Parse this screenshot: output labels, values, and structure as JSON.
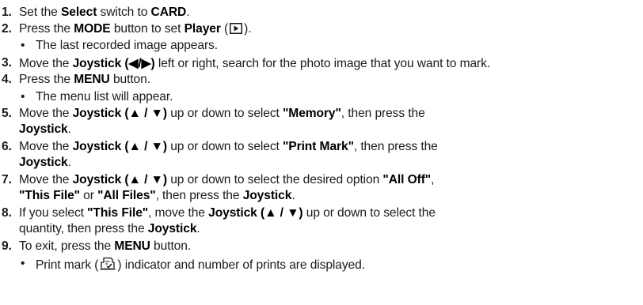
{
  "steps": [
    {
      "num": "1.",
      "a": "Set the ",
      "b1": "Select",
      "c": " switch to ",
      "b2": "CARD",
      "d": "."
    },
    {
      "num": "2.",
      "a": "Press the ",
      "b1": "MODE",
      "c": " button to set ",
      "b2": "Player",
      "d": " (",
      "e": ").",
      "icon": "play-mode-icon"
    },
    {
      "bullet": "The last recorded image appears."
    },
    {
      "num": "3.",
      "a": "Move the ",
      "b1": "Joystick (◀/▶)",
      "c": " left or right, search for the photo image that you want to mark."
    },
    {
      "num": "4.",
      "a": "Press the ",
      "b1": "MENU",
      "c": " button."
    },
    {
      "bullet": "The menu list will appear."
    },
    {
      "num": "5.",
      "a": "Move the ",
      "b1": "Joystick (▲ / ▼)",
      "c": " up or down to select ",
      "b2": "\"Memory\"",
      "d": ", then press the",
      "line2": "Joystick",
      "line2_end": "."
    },
    {
      "num": "6.",
      "a": "Move the ",
      "b1": "Joystick (▲ / ▼)",
      "c": " up or down to select ",
      "b2": "\"Print Mark\"",
      "d": ", then press the",
      "line2": "Joystick",
      "line2_end": "."
    },
    {
      "num": "7.",
      "a": "Move the ",
      "b1": "Joystick (▲ / ▼)",
      "c": " up or down to select the desired option ",
      "b2": "\"All Off\"",
      "d": ",",
      "l2a": "\"This File\"",
      "l2b": " or ",
      "l2c": "\"All Files\"",
      "l2d": ", then press the ",
      "l2e": "Joystick",
      "l2f": "."
    },
    {
      "num": "8.",
      "a": "If you select ",
      "b1": "\"This File\"",
      "c": ", move the ",
      "b2": "Joystick (▲ / ▼)",
      "d": " up or down to select the",
      "l2a": "quantity, then press the ",
      "l2b": "Joystick",
      "l2c": "."
    },
    {
      "num": "9.",
      "a": "To exit, press the ",
      "b1": "MENU",
      "c": " button."
    },
    {
      "bullet": "Print mark (",
      "bullet_end": ") indicator and number of prints are displayed.",
      "icon": "print-mark-icon"
    }
  ],
  "bullet_char": "•",
  "icons": [
    "play-mode-icon",
    "print-mark-icon"
  ]
}
